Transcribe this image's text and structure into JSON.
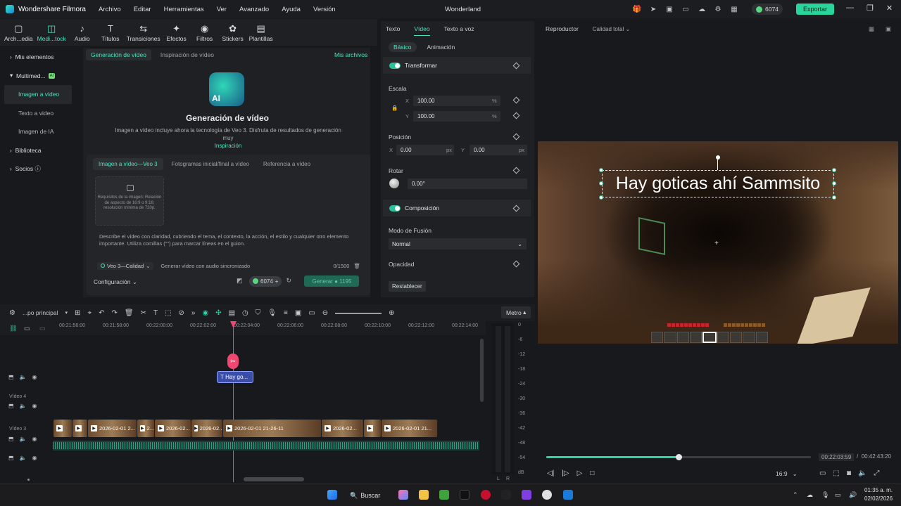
{
  "app": {
    "name": "Wondershare Filmora",
    "title": "Wonderland"
  },
  "menu": [
    "Archivo",
    "Editar",
    "Herramientas",
    "Ver",
    "Avanzado",
    "Ayuda",
    "Versión"
  ],
  "titlebar": {
    "credits": "6074",
    "export": "Exportar"
  },
  "toolbar": [
    {
      "label": "Arch...edia",
      "icon": "media-icon"
    },
    {
      "label": "Medi...tock",
      "icon": "stock-icon"
    },
    {
      "label": "Audio",
      "icon": "audio-icon"
    },
    {
      "label": "Títulos",
      "icon": "titles-icon"
    },
    {
      "label": "Transiciones",
      "icon": "transitions-icon"
    },
    {
      "label": "Efectos",
      "icon": "effects-icon"
    },
    {
      "label": "Filtros",
      "icon": "filters-icon"
    },
    {
      "label": "Stickers",
      "icon": "stickers-icon"
    },
    {
      "label": "Plantillas",
      "icon": "templates-icon"
    }
  ],
  "sidebar": {
    "items": [
      {
        "label": "Mis elementos"
      },
      {
        "label": "Multimed...",
        "badge": "AI"
      },
      {
        "label": "Imagen a video"
      },
      {
        "label": "Texto a video"
      },
      {
        "label": "Imagen de IA"
      },
      {
        "label": "Biblioteca"
      },
      {
        "label": "Socios"
      }
    ]
  },
  "main": {
    "tabs": [
      "Generación de vídeo",
      "Inspiración de vídeo"
    ],
    "my_files": "Mis archivos",
    "ai_label": "AI",
    "heading": "Generación de vídeo",
    "description": "Imagen a vídeo incluye ahora la tecnología de Veo 3. Disfruta de resultados de generación muy",
    "link": "Inspiración",
    "subtabs": [
      "Imagen a vídeo—Veo 3",
      "Fotogramas inicial/final a vídeo",
      "Referencia a vídeo"
    ],
    "upload_text": "Requisitos de la imagen: Relación de aspecto de 16:9 o 9:16; resolución mínima de 720p.",
    "prompt": "Describe el vídeo con claridad, cubriendo el tema, el contexto, la acción, el estilo y cualquier otro elemento importante. Utiliza comillas (\"\") para marcar líneas en el guion.",
    "model": "Veo 3—Calidad",
    "audio_option": "Generar vídeo con audio sincronizado",
    "counter": "0/1500",
    "config": "Configuración",
    "cost": "6074",
    "generate": "Generar",
    "generate_cost": "1195"
  },
  "props": {
    "tabs": [
      "Texto",
      "Vídeo",
      "Texto a voz"
    ],
    "subtabs": [
      "Básico",
      "Animación"
    ],
    "transform": "Transformar",
    "scale_label": "Escala",
    "scale_x": "100.00",
    "scale_y": "100.00",
    "percent": "%",
    "position_label": "Posición",
    "pos_x": "0.00",
    "pos_y": "0.00",
    "px": "px",
    "rotate_label": "Rotar",
    "rotate": "0.00°",
    "composition": "Composición",
    "blend_label": "Modo de Fusión",
    "blend": "Normal",
    "opacity_label": "Opacidad",
    "reset": "Restablecer",
    "x": "X",
    "y": "Y"
  },
  "player": {
    "label": "Reproductor",
    "quality": "Calidad total",
    "caption": "Hay goticas ahí Sammsito",
    "current": "00:22:03:59",
    "total": "00:42:43:20",
    "separator": "/",
    "progress": 0.5,
    "ratio": "16:9"
  },
  "timeline": {
    "name": "...po principal",
    "zoom": "Metro",
    "ticks": [
      "00:21:56:00",
      "00:21:58:00",
      "00:22:00:00",
      "00:22:02:00",
      "00:22:04:00",
      "00:22:06:00",
      "00:22:08:00",
      "00:22:10:00",
      "00:22:12:00",
      "00:22:14:00"
    ],
    "tracks": [
      "Vídeo 4",
      "Vídeo 3"
    ],
    "title_clip": "Hay go...",
    "clips": [
      "",
      "",
      "2026-02-01 2...",
      "2...",
      "2026-02...",
      "2026-02...",
      "2026-02-01 21-26-11",
      "2026-02...",
      "",
      "2026-02-01 21..."
    ],
    "meter": [
      "0",
      "-6",
      "-12",
      "-18",
      "-24",
      "-30",
      "-36",
      "-42",
      "-48",
      "-54",
      "dB"
    ],
    "meter_lr": [
      "L",
      "R"
    ]
  },
  "taskbar": {
    "search": "Buscar",
    "time": "01:35 a. m.",
    "date": "02/02/2026"
  }
}
